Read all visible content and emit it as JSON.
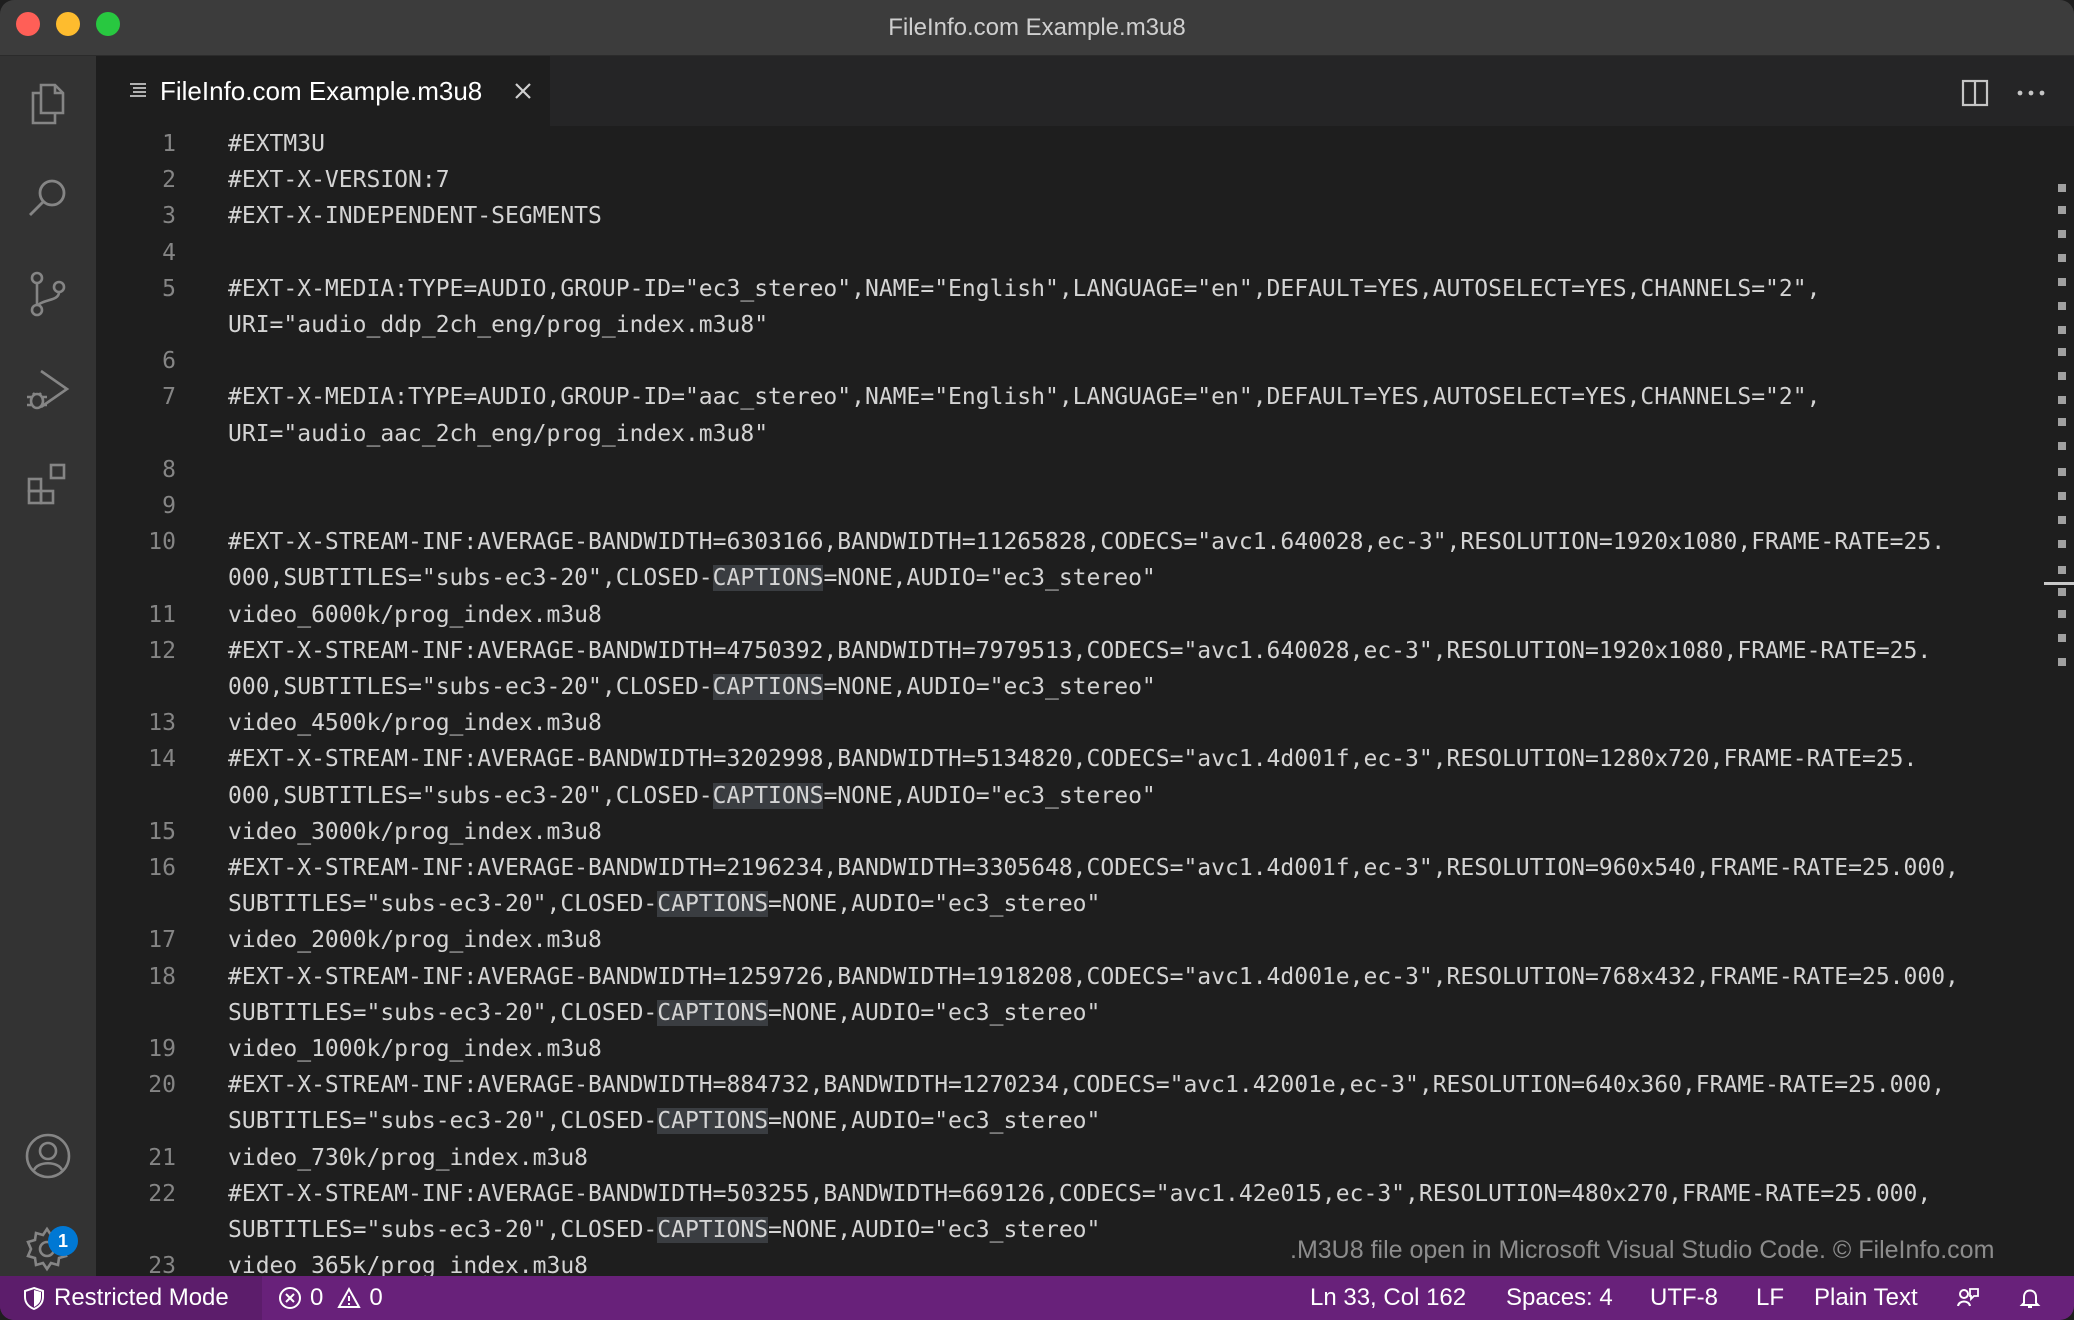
{
  "window": {
    "title": "FileInfo.com Example.m3u8"
  },
  "activity_bar": {
    "items": [
      "explorer-icon",
      "search-icon",
      "source-control-icon",
      "run-debug-icon",
      "extensions-icon"
    ],
    "bottom_items": [
      "accounts-icon",
      "settings-gear-icon"
    ],
    "settings_badge": "1"
  },
  "tab": {
    "label": "FileInfo.com Example.m3u8",
    "icon": "plain-text-file-icon"
  },
  "editor": {
    "lines": [
      {
        "n": "1",
        "text": "#EXTM3U"
      },
      {
        "n": "2",
        "text": "#EXT-X-VERSION:7"
      },
      {
        "n": "3",
        "text": "#EXT-X-INDEPENDENT-SEGMENTS"
      },
      {
        "n": "4",
        "text": ""
      },
      {
        "n": "5",
        "text": "#EXT-X-MEDIA:TYPE=AUDIO,GROUP-ID=\"ec3_stereo\",NAME=\"English\",LANGUAGE=\"en\",DEFAULT=YES,AUTOSELECT=YES,CHANNELS=\"2\","
      },
      {
        "n": "",
        "text": "URI=\"audio_ddp_2ch_eng/prog_index.m3u8\""
      },
      {
        "n": "6",
        "text": ""
      },
      {
        "n": "7",
        "text": "#EXT-X-MEDIA:TYPE=AUDIO,GROUP-ID=\"aac_stereo\",NAME=\"English\",LANGUAGE=\"en\",DEFAULT=YES,AUTOSELECT=YES,CHANNELS=\"2\","
      },
      {
        "n": "",
        "text": "URI=\"audio_aac_2ch_eng/prog_index.m3u8\""
      },
      {
        "n": "8",
        "text": ""
      },
      {
        "n": "9",
        "text": ""
      },
      {
        "n": "10",
        "text": "#EXT-X-STREAM-INF:AVERAGE-BANDWIDTH=6303166,BANDWIDTH=11265828,CODECS=\"avc1.640028,ec-3\",RESOLUTION=1920x1080,FRAME-RATE=25."
      },
      {
        "n": "",
        "pre": "000,SUBTITLES=\"subs-ec3-20\",CLOSED-",
        "hl": "CAPTIONS",
        "post": "=NONE,AUDIO=\"ec3_stereo\""
      },
      {
        "n": "11",
        "text": "video_6000k/prog_index.m3u8"
      },
      {
        "n": "12",
        "text": "#EXT-X-STREAM-INF:AVERAGE-BANDWIDTH=4750392,BANDWIDTH=7979513,CODECS=\"avc1.640028,ec-3\",RESOLUTION=1920x1080,FRAME-RATE=25."
      },
      {
        "n": "",
        "pre": "000,SUBTITLES=\"subs-ec3-20\",CLOSED-",
        "hl": "CAPTIONS",
        "post": "=NONE,AUDIO=\"ec3_stereo\""
      },
      {
        "n": "13",
        "text": "video_4500k/prog_index.m3u8"
      },
      {
        "n": "14",
        "text": "#EXT-X-STREAM-INF:AVERAGE-BANDWIDTH=3202998,BANDWIDTH=5134820,CODECS=\"avc1.4d001f,ec-3\",RESOLUTION=1280x720,FRAME-RATE=25."
      },
      {
        "n": "",
        "pre": "000,SUBTITLES=\"subs-ec3-20\",CLOSED-",
        "hl": "CAPTIONS",
        "post": "=NONE,AUDIO=\"ec3_stereo\""
      },
      {
        "n": "15",
        "text": "video_3000k/prog_index.m3u8"
      },
      {
        "n": "16",
        "text": "#EXT-X-STREAM-INF:AVERAGE-BANDWIDTH=2196234,BANDWIDTH=3305648,CODECS=\"avc1.4d001f,ec-3\",RESOLUTION=960x540,FRAME-RATE=25.000,"
      },
      {
        "n": "",
        "pre": "SUBTITLES=\"subs-ec3-20\",CLOSED-",
        "hl": "CAPTIONS",
        "post": "=NONE,AUDIO=\"ec3_stereo\""
      },
      {
        "n": "17",
        "text": "video_2000k/prog_index.m3u8"
      },
      {
        "n": "18",
        "text": "#EXT-X-STREAM-INF:AVERAGE-BANDWIDTH=1259726,BANDWIDTH=1918208,CODECS=\"avc1.4d001e,ec-3\",RESOLUTION=768x432,FRAME-RATE=25.000,"
      },
      {
        "n": "",
        "pre": "SUBTITLES=\"subs-ec3-20\",CLOSED-",
        "hl": "CAPTIONS",
        "post": "=NONE,AUDIO=\"ec3_stereo\""
      },
      {
        "n": "19",
        "text": "video_1000k/prog_index.m3u8"
      },
      {
        "n": "20",
        "text": "#EXT-X-STREAM-INF:AVERAGE-BANDWIDTH=884732,BANDWIDTH=1270234,CODECS=\"avc1.42001e,ec-3\",RESOLUTION=640x360,FRAME-RATE=25.000,"
      },
      {
        "n": "",
        "pre": "SUBTITLES=\"subs-ec3-20\",CLOSED-",
        "hl": "CAPTIONS",
        "post": "=NONE,AUDIO=\"ec3_stereo\""
      },
      {
        "n": "21",
        "text": "video_730k/prog_index.m3u8"
      },
      {
        "n": "22",
        "text": "#EXT-X-STREAM-INF:AVERAGE-BANDWIDTH=503255,BANDWIDTH=669126,CODECS=\"avc1.42e015,ec-3\",RESOLUTION=480x270,FRAME-RATE=25.000,"
      },
      {
        "n": "",
        "pre": "SUBTITLES=\"subs-ec3-20\",CLOSED-",
        "hl": "CAPTIONS",
        "post": "=NONE,AUDIO=\"ec3_stereo\""
      },
      {
        "n": "23",
        "text": "video_365k/prog_index.m3u8"
      }
    ],
    "caption": ".M3U8 file open in Microsoft Visual Studio Code. © FileInfo.com"
  },
  "status_bar": {
    "restricted_mode": "Restricted Mode",
    "errors": "0",
    "warnings": "0",
    "cursor_position": "Ln 33, Col 162",
    "indentation": "Spaces: 4",
    "encoding": "UTF-8",
    "eol": "LF",
    "language": "Plain Text",
    "background": "#68217a"
  }
}
